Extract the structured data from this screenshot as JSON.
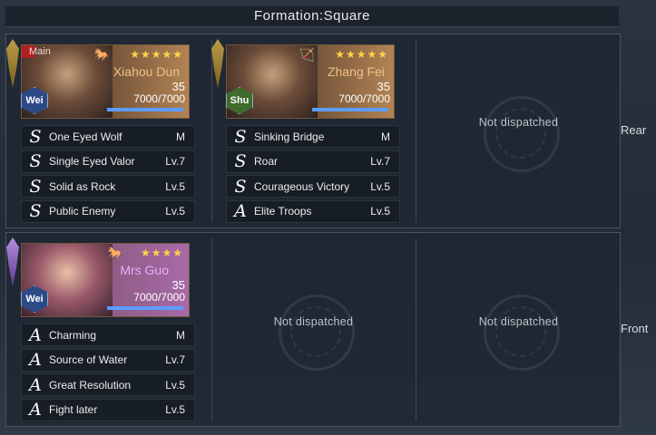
{
  "header": {
    "title": "Formation:Square"
  },
  "rows": {
    "rear_label": "Rear",
    "front_label": "Front"
  },
  "empty_slot_text": "Not dispatched",
  "heroes": {
    "xiahou": {
      "main_label": "Main",
      "name": "Xiahou Dun",
      "stars": "★★★★★",
      "level": "35",
      "troops": "7000/7000",
      "troop_fill": 1.0,
      "faction": "Wei",
      "class_icon": "cavalry-icon",
      "skills": [
        {
          "grade": "S",
          "name": "One Eyed Wolf",
          "lv": "M"
        },
        {
          "grade": "S",
          "name": "Single Eyed Valor",
          "lv": "Lv.7"
        },
        {
          "grade": "S",
          "name": "Solid as Rock",
          "lv": "Lv.5"
        },
        {
          "grade": "S",
          "name": "Public Enemy",
          "lv": "Lv.5"
        }
      ]
    },
    "zhangfei": {
      "name": "Zhang Fei",
      "stars": "★★★★★",
      "level": "35",
      "troops": "7000/7000",
      "troop_fill": 1.0,
      "faction": "Shu",
      "class_icon": "archer-icon",
      "skills": [
        {
          "grade": "S",
          "name": "Sinking Bridge",
          "lv": "M"
        },
        {
          "grade": "S",
          "name": "Roar",
          "lv": "Lv.7"
        },
        {
          "grade": "S",
          "name": "Courageous Victory",
          "lv": "Lv.5"
        },
        {
          "grade": "A",
          "name": "Elite Troops",
          "lv": "Lv.5"
        }
      ]
    },
    "mrsguo": {
      "name": "Mrs Guo",
      "stars": "★★★★",
      "level": "35",
      "troops": "7000/7000",
      "troop_fill": 1.0,
      "faction": "Wei",
      "class_icon": "cavalry-icon",
      "skills": [
        {
          "grade": "A",
          "name": "Charming",
          "lv": "M"
        },
        {
          "grade": "A",
          "name": "Source of Water",
          "lv": "Lv.7"
        },
        {
          "grade": "A",
          "name": "Great Resolution",
          "lv": "Lv.5"
        },
        {
          "grade": "A",
          "name": "Fight later",
          "lv": "Lv.5"
        }
      ]
    }
  },
  "colors": {
    "troop_bar": "#5b9dff",
    "name_gold": "#f0c088",
    "name_purple": "#e0b0ff"
  }
}
